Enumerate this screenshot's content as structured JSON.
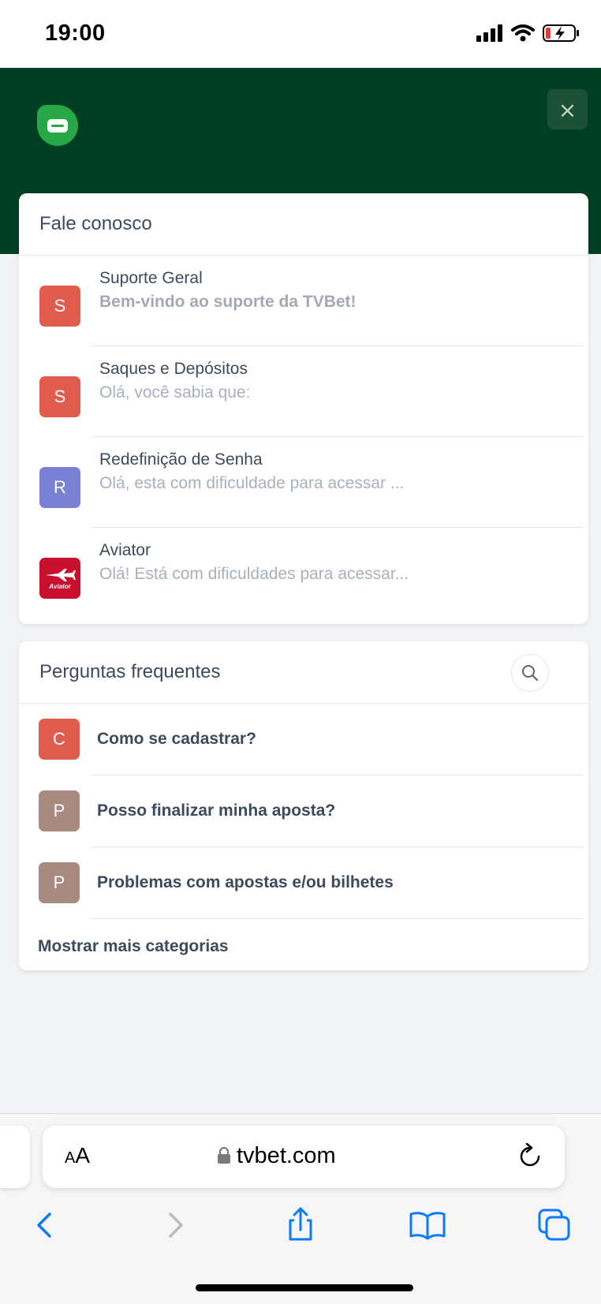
{
  "status_bar": {
    "time": "19:00"
  },
  "header": {
    "close_label": "×"
  },
  "contact": {
    "title": "Fale conosco",
    "items": [
      {
        "avatar": "S",
        "color": "#e05d4d",
        "name": "Suporte Geral",
        "message": "Bem-vindo ao suporte da TVBet!"
      },
      {
        "avatar": "S",
        "color": "#e05d4d",
        "name": "Saques e Depósitos",
        "message": "Olá, você sabia que:"
      },
      {
        "avatar": "R",
        "color": "#7a80d3",
        "name": "Redefinição de Senha",
        "message": "Olá, esta com dificuldade para acessar ..."
      },
      {
        "avatar": "Aviator",
        "color": "#c8102e",
        "name": "Aviator",
        "message": "Olá! Está com dificuldades para acessar..."
      }
    ]
  },
  "faq": {
    "title": "Perguntas frequentes",
    "items": [
      {
        "avatar": "C",
        "color": "#e05d4d",
        "text": "Como se cadastrar?"
      },
      {
        "avatar": "P",
        "color": "#a98a80",
        "text": "Posso finalizar minha aposta?"
      },
      {
        "avatar": "P",
        "color": "#a98a80",
        "text": "Problemas com apostas e/ou bilhetes"
      }
    ],
    "show_more": "Mostrar mais categorias"
  },
  "browser": {
    "aa_small": "A",
    "aa_large": "A",
    "url": "tvbet.com",
    "accent": "#0a7aff"
  }
}
